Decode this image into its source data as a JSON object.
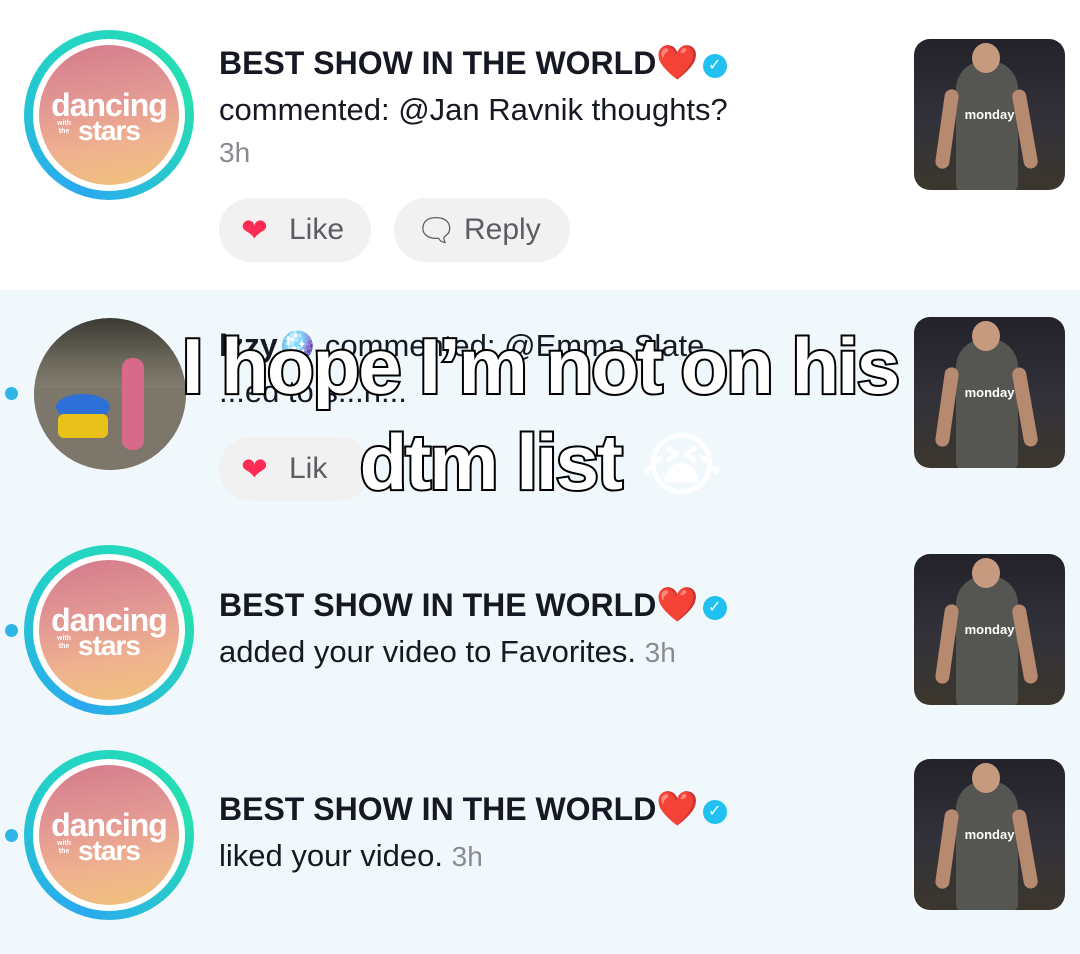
{
  "notifications": [
    {
      "name": "BEST SHOW IN THE WORLD",
      "name_emoji": "❤️",
      "verified_icon": "verified-badge-icon",
      "action": "commented: @Jan Ravnik thoughts?",
      "time": "3h",
      "avatar_logo": {
        "line1": "dancing",
        "small": "with the",
        "line2": "stars"
      },
      "thumb_caption": "monday",
      "like_label": "Like",
      "reply_label": "Reply"
    },
    {
      "name": "Izzy",
      "name_emoji": "🪩",
      "action_start": "commented: @Emma Slate",
      "action_line2": "...ed to s...h...",
      "like_label": "Lik",
      "thumb_caption": "monday"
    },
    {
      "name": "BEST SHOW IN THE WORLD",
      "name_emoji": "❤️",
      "action": "added your video to Favorites.",
      "time": "3h",
      "avatar_logo": {
        "line1": "dancing",
        "small": "with the",
        "line2": "stars"
      },
      "thumb_caption": "monday"
    },
    {
      "name": "BEST SHOW IN THE WORLD",
      "name_emoji": "❤️",
      "action": "liked your video.",
      "time": "3h",
      "avatar_logo": {
        "line1": "dancing",
        "small": "with the",
        "line2": "stars"
      },
      "thumb_caption": "monday"
    }
  ],
  "overlay_caption": {
    "line1": "I hope I’m not on his",
    "line2": "dtm list",
    "emoji": "😭"
  },
  "colors": {
    "unread_bg": "#f1f8fb",
    "unread_dot": "#2fb6e6",
    "verified": "#20c0f0",
    "heart": "#d9182b",
    "time": "#8a8b91"
  }
}
